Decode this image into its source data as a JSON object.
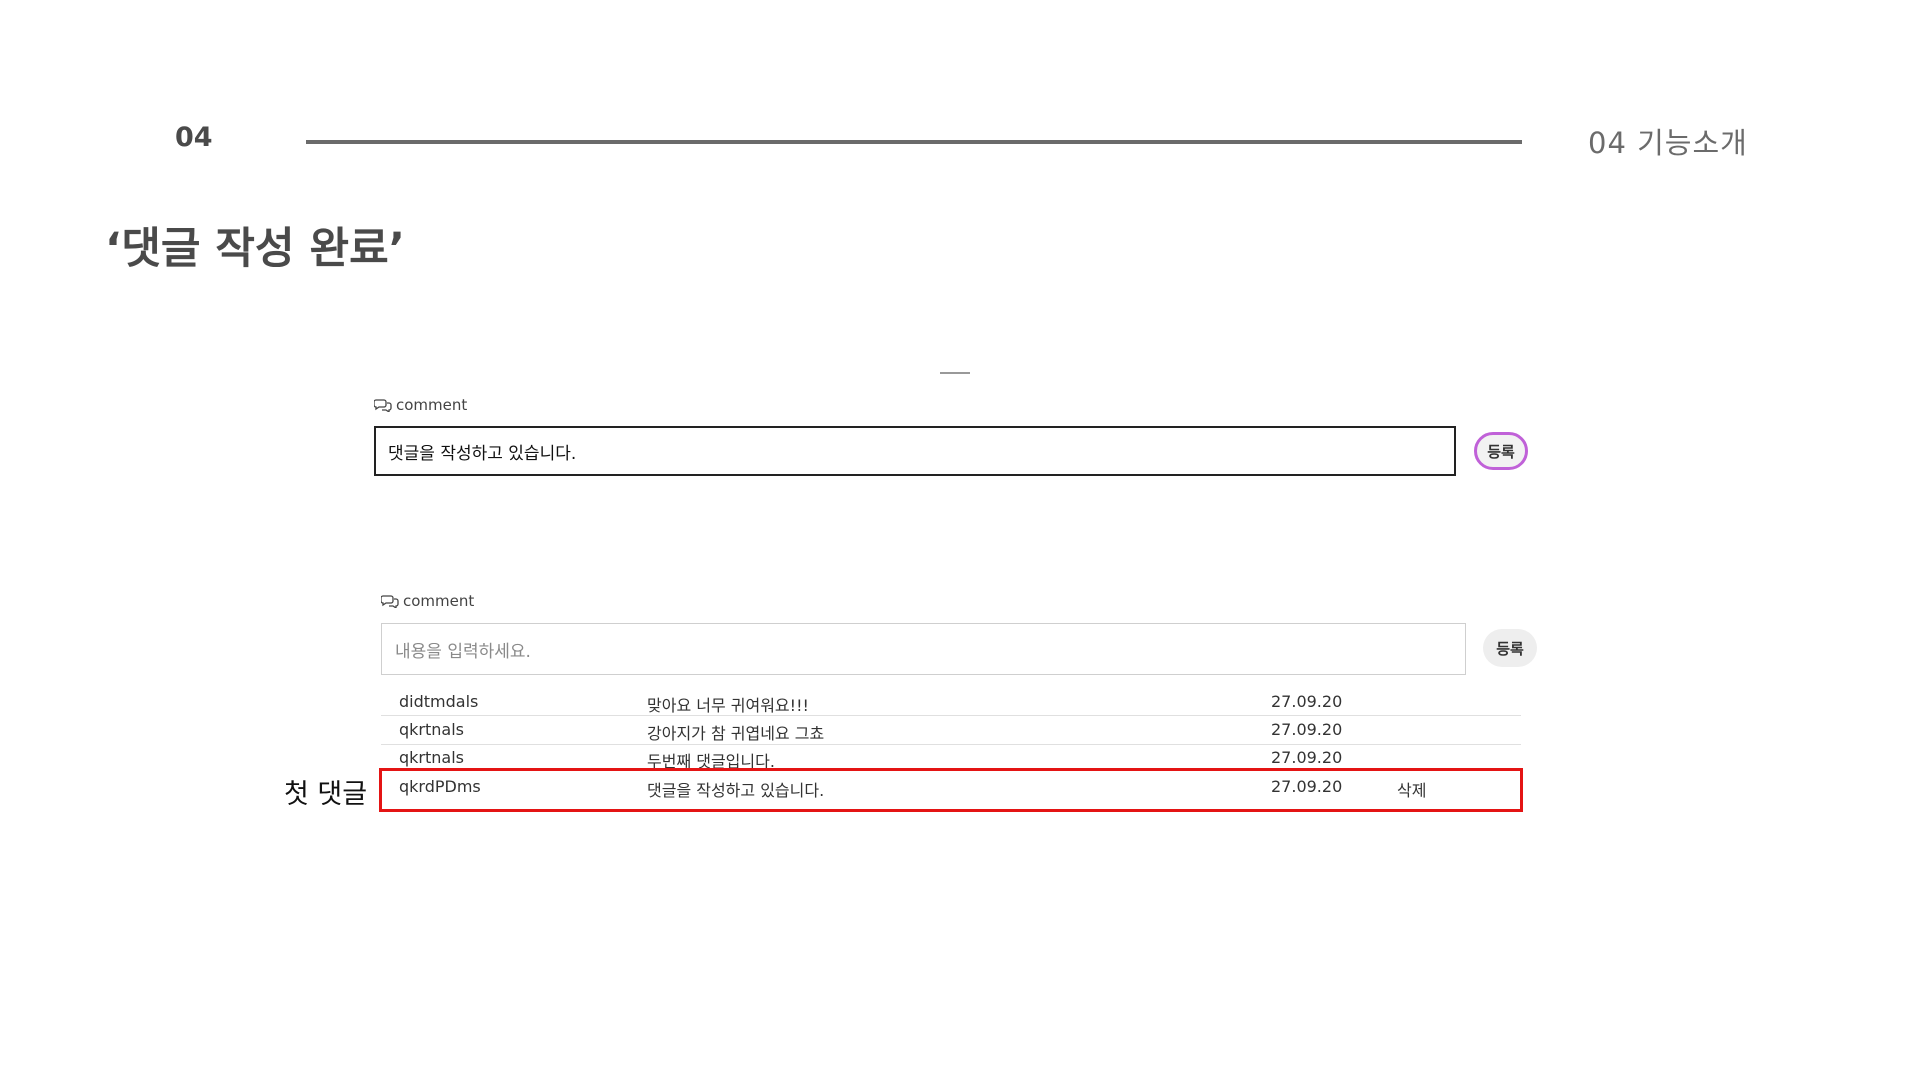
{
  "header": {
    "slide_number": "04",
    "section_label": "04  기능소개",
    "title": "‘댓글 작성 완료’"
  },
  "form_top": {
    "label": "comment",
    "input_value": "댓글을 작성하고 있습니다.",
    "submit_label": "등록"
  },
  "form_bottom": {
    "label": "comment",
    "input_placeholder": "내용을 입력하세요.",
    "submit_label": "등록"
  },
  "comments": [
    {
      "user": "didtmdals",
      "text": "맞아요 너무 귀여워요!!!",
      "date": "27.09.20",
      "action": ""
    },
    {
      "user": "qkrtnals",
      "text": "강아지가 참 귀엽네요 그쵸",
      "date": "27.09.20",
      "action": ""
    },
    {
      "user": "qkrtnals",
      "text": "두번째 댓글입니다.",
      "date": "27.09.20",
      "action": ""
    },
    {
      "user": "qkrdPDms",
      "text": "댓글을 작성하고 있습니다.",
      "date": "27.09.20",
      "action": "삭제"
    }
  ],
  "annotation": {
    "label": "첫 댓글",
    "highlight_color": "#e41414"
  },
  "colors": {
    "accent_button_border": "#c061d8"
  },
  "icons": {
    "comment": "chat-bubbles-icon"
  }
}
